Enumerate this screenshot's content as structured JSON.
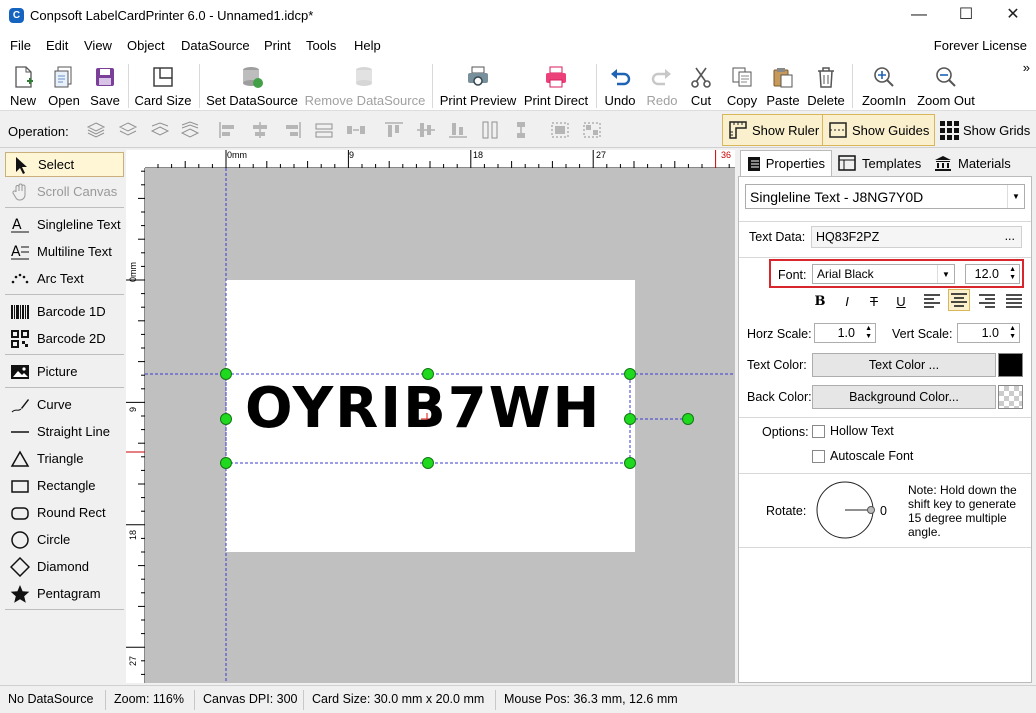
{
  "window": {
    "title": "Conpsoft LabelCardPrinter 6.0 - Unnamed1.idcp*",
    "app_icon": "C",
    "minimize": "—",
    "maximize": "☐",
    "close": "✕"
  },
  "menu": [
    "File",
    "Edit",
    "View",
    "Object",
    "DataSource",
    "Print",
    "Tools",
    "Help"
  ],
  "license": "Forever License",
  "toolbar": {
    "new": "New",
    "open": "Open",
    "save": "Save",
    "card_size": "Card Size",
    "set_datasource": "Set DataSource",
    "remove_datasource": "Remove DataSource",
    "print_preview": "Print Preview",
    "print_direct": "Print Direct",
    "undo": "Undo",
    "redo": "Redo",
    "cut": "Cut",
    "copy": "Copy",
    "paste": "Paste",
    "delete": "Delete",
    "zoom_in": "ZoomIn",
    "zoom_out": "Zoom Out",
    "overflow": "»"
  },
  "operation_bar": {
    "label": "Operation:",
    "show_ruler": "Show Ruler",
    "show_guides": "Show Guides",
    "show_grids": "Show Grids"
  },
  "tools": {
    "select": "Select",
    "scroll_canvas": "Scroll Canvas",
    "singleline_text": "Singleline Text",
    "multiline_text": "Multiline Text",
    "arc_text": "Arc Text",
    "barcode_1d": "Barcode 1D",
    "barcode_2d": "Barcode 2D",
    "picture": "Picture",
    "curve": "Curve",
    "straight_line": "Straight Line",
    "triangle": "Triangle",
    "rectangle": "Rectangle",
    "round_rect": "Round Rect",
    "circle": "Circle",
    "diamond": "Diamond",
    "pentagram": "Pentagram"
  },
  "ruler": {
    "h_unit": "0mm",
    "h_ticks": [
      "9",
      "18",
      "27",
      "36"
    ],
    "v_unit": "0mm",
    "v_ticks": [
      "9",
      "18",
      "27"
    ]
  },
  "canvas": {
    "label_text": "OYRIB7WH"
  },
  "properties": {
    "tabs": {
      "properties": "Properties",
      "templates": "Templates",
      "materials": "Materials"
    },
    "object_selector": "Singleline Text - J8NG7Y0D",
    "text_data_label": "Text Data:",
    "text_data_value": "HQ83F2PZ",
    "text_data_more": "...",
    "font_label": "Font:",
    "font_value": "Arial Black",
    "font_size": "12.0",
    "bold": "B",
    "italic": "I",
    "strike": "T",
    "underline": "U",
    "horz_scale_label": "Horz Scale:",
    "horz_scale": "1.0",
    "vert_scale_label": "Vert Scale:",
    "vert_scale": "1.0",
    "text_color_label": "Text Color:",
    "text_color_button": "Text Color ...",
    "text_color": "#000000",
    "back_color_label": "Back Color:",
    "back_color_button": "Background Color...",
    "options_label": "Options:",
    "hollow_text": "Hollow Text",
    "autoscale_font": "Autoscale Font",
    "rotate_label": "Rotate:",
    "rotate_value": "0",
    "rotate_note": "Note: Hold down the shift key to generate 15 degree multiple angle."
  },
  "status": {
    "datasource": "No DataSource",
    "zoom": "Zoom: 116%",
    "dpi": "Canvas DPI: 300",
    "card_size": "Card Size: 30.0 mm x 20.0 mm",
    "mouse_pos": "Mouse Pos: 36.3 mm, 12.6 mm"
  },
  "colors": {
    "handle": "#1fd91f",
    "guide": "#3b3bcf",
    "highlight_border": "#d9262c",
    "toggle_bg": "#fbf0cd"
  }
}
